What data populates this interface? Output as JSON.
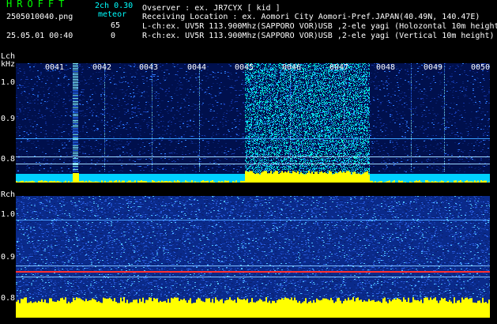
{
  "header": {
    "logo": "HROFFT",
    "mode": "2ch 0.30",
    "filename": "2505010040.png",
    "type_label": "meteor",
    "timestamp": "25.05.01 00:40",
    "lch_count": "65",
    "rch_count": "0",
    "observer": "Ovserver                  : ex. JR7CYX [ kid ]",
    "location": "Receiving Location : ex. Aomori City Aomori-Pref.JAPAN(40.49N, 140.47E)",
    "lch_info": "L-ch:ex. UV5R 113.900Mhz(SAPPORO VOR)USB ,2-ele yagi (Holozontal 10m height)",
    "rch_info": "R-ch:ex. UV5R 113.900Mhz(SAPPORO VOR)USB ,2-ele yagi (Vertical 10m height)"
  },
  "lch": {
    "label": "Lch",
    "unit": "kHz",
    "yticks": [
      "1.0",
      "0.9",
      "0.8"
    ],
    "time_labels": [
      "0041",
      "0042",
      "0043",
      "0044",
      "0045",
      "0046",
      "0047",
      "0048",
      "0049",
      "0050"
    ]
  },
  "rch": {
    "label": "Rch",
    "yticks": [
      "1.0",
      "0.9",
      "0.8"
    ]
  },
  "colors": {
    "background": "#000000",
    "header_green": "#00ff00",
    "header_cyan": "#00ffff",
    "header_white": "#ffffff",
    "noise_dark": "#001a66",
    "noise_mid": "#1a4fcc",
    "signal_cyan": "#00e0ff",
    "level_yellow": "#ffff00",
    "carrier_red": "#ff3030"
  }
}
